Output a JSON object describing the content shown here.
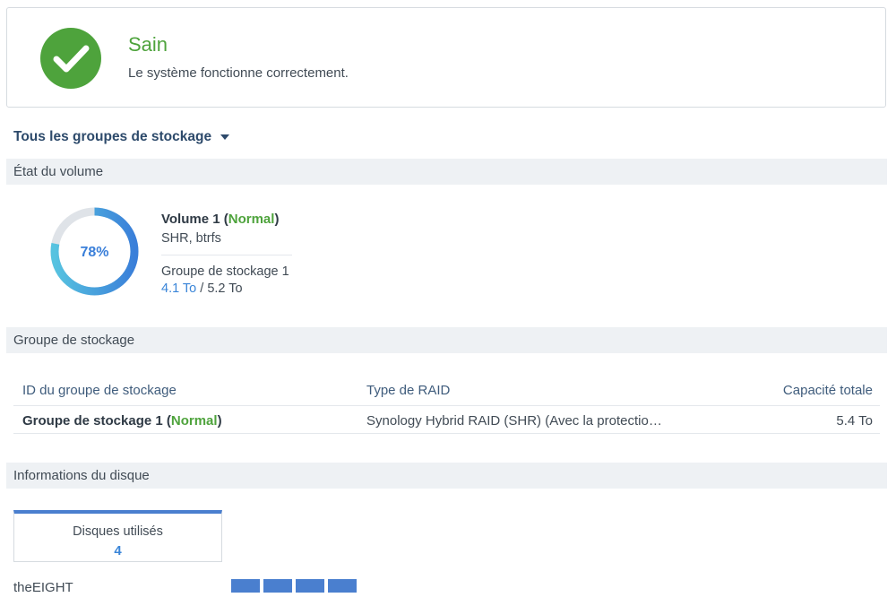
{
  "health": {
    "status_title": "Sain",
    "status_description": "Le système fonctionne correctement.",
    "status_color": "#4ea33c",
    "icon": "check-circle-icon"
  },
  "group_selector": {
    "label": "Tous les groupes de stockage",
    "icon": "caret-down-icon"
  },
  "volume_section": {
    "header": "État du volume",
    "usage_percent_label": "78%",
    "usage_fraction": 0.78,
    "volume_name": "Volume 1",
    "volume_status": "Normal",
    "open_paren": " (",
    "close_paren": ")",
    "volume_type": "SHR, btrfs",
    "pool_name": "Groupe de stockage 1",
    "used": "4.1 To",
    "separator": " / ",
    "total": "5.2 To"
  },
  "pool_section": {
    "header": "Groupe de stockage",
    "columns": [
      "ID du groupe de stockage",
      "Type de RAID",
      "Capacité totale"
    ],
    "rows": [
      {
        "id": "Groupe de stockage 1",
        "status": "Normal",
        "raid": "Synology Hybrid RAID (SHR) (Avec la protectio…",
        "capacity": "5.4 To"
      }
    ]
  },
  "disk_section": {
    "header": "Informations du disque",
    "card_label": "Disques utilisés",
    "card_count": "4",
    "host_name": "theEIGHT",
    "slot_count": 4
  },
  "colors": {
    "accent_blue": "#3a85d8",
    "ok_green": "#4ea33c",
    "slot_blue": "#4a7fcf"
  }
}
